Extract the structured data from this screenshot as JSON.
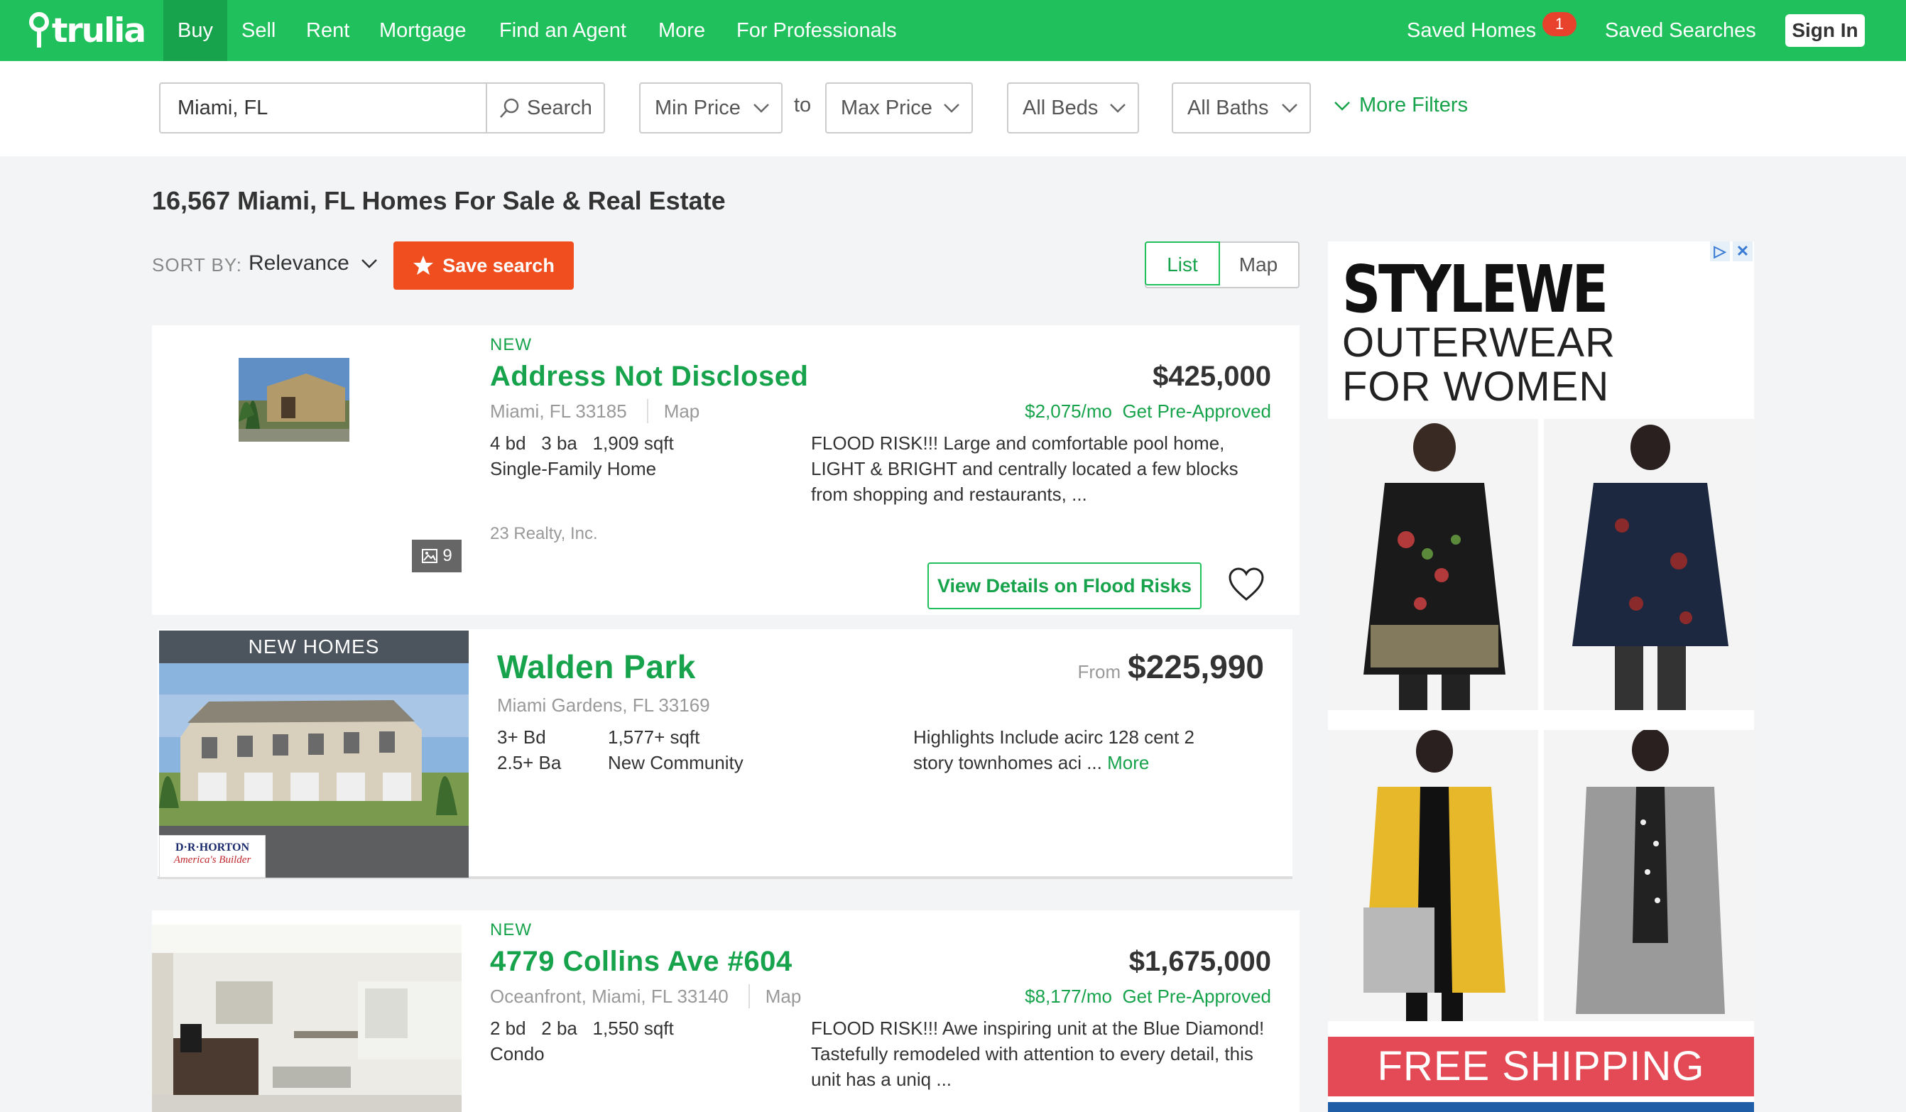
{
  "nav": {
    "logo_text": "trulia",
    "items": [
      {
        "label": "Buy"
      },
      {
        "label": "Sell"
      },
      {
        "label": "Rent"
      },
      {
        "label": "Mortgage"
      },
      {
        "label": "Find an Agent"
      },
      {
        "label": "More"
      },
      {
        "label": "For Professionals"
      }
    ],
    "saved_homes": "Saved Homes",
    "saved_homes_count": "1",
    "saved_searches": "Saved Searches",
    "sign_in": "Sign In"
  },
  "search": {
    "location_value": "Miami, FL",
    "search_button": "Search",
    "min_price": "Min Price",
    "to": "to",
    "max_price": "Max Price",
    "beds": "All Beds",
    "baths": "All Baths",
    "more_filters": "More Filters"
  },
  "results": {
    "title": "16,567 Miami, FL Homes For Sale & Real Estate",
    "sort_label": "SORT BY:",
    "sort_value": "Relevance",
    "save_search": "Save search",
    "view_list": "List",
    "view_map": "Map"
  },
  "listings": [
    {
      "tag": "NEW",
      "address": "Address Not Disclosed",
      "location": "Miami, FL 33185",
      "map_link": "Map",
      "price": "$425,000",
      "monthly": "$2,075/mo",
      "preapproved": "Get Pre-Approved",
      "facts_line1": "4 bd   3 ba   1,909 sqft",
      "facts_line2": "Single-Family Home",
      "description": "FLOOD RISK!!! Large and comfortable pool home, LIGHT & BRIGHT and centrally located a few blocks from shopping and restaurants, ...",
      "broker": "23 Realty, Inc.",
      "photo_count": "9",
      "flood_button": "View Details on Flood Risks"
    },
    {
      "label": "NEW HOMES",
      "name": "Walden Park",
      "location": "Miami Gardens, FL 33169",
      "from": "From",
      "price": "$225,990",
      "beds": "3+ Bd",
      "baths": "2.5+ Ba",
      "sqft": "1,577+ sqft",
      "type": "New Community",
      "description": "Highlights Include acirc 128 cent 2 story townhomes aci ...",
      "more": "More",
      "builder_logo_line1": "D·R·HORTON",
      "builder_logo_line2": "America's Builder"
    },
    {
      "tag": "NEW",
      "address": "4779 Collins Ave #604",
      "location": "Oceanfront, Miami, FL 33140",
      "map_link": "Map",
      "price": "$1,675,000",
      "monthly": "$8,177/mo",
      "preapproved": "Get Pre-Approved",
      "facts_line1": "2 bd   2 ba   1,550 sqft",
      "facts_line2": "Condo",
      "description": "FLOOD RISK!!! Awe inspiring unit at the Blue Diamond! Tastefully remodeled with attention to every detail, this unit has a uniq ..."
    }
  ],
  "ad": {
    "brand": "STYLEWE",
    "headline_line1": "OUTERWEAR",
    "headline_line2": "FOR WOMEN",
    "footer": "FREE SHIPPING",
    "adchoices": "▷",
    "close": "✕"
  },
  "colors": {
    "brand_green": "#20c05c",
    "active_green": "#17a34b",
    "save_orange": "#f14e1f",
    "badge_red": "#e8412c"
  }
}
